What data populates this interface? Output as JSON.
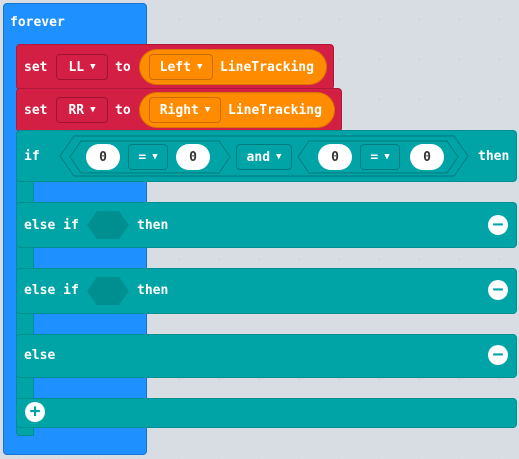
{
  "forever": {
    "label": "forever"
  },
  "set_ll": {
    "set": "set",
    "var": "LL",
    "to": "to",
    "side": "Left",
    "func": "LineTracking"
  },
  "set_rr": {
    "set": "set",
    "var": "RR",
    "to": "to",
    "side": "Right",
    "func": "LineTracking"
  },
  "if_block": {
    "if": "if",
    "left_a": "0",
    "op_a": "=",
    "right_a": "0",
    "and": "and",
    "left_b": "0",
    "op_b": "=",
    "right_b": "0",
    "then": "then"
  },
  "elseif1": {
    "label": "else if",
    "then": "then"
  },
  "elseif2": {
    "label": "else if",
    "then": "then"
  },
  "else": {
    "label": "else"
  },
  "icons": {
    "remove": "minus-circle-icon",
    "add": "plus-circle-icon",
    "dropdown": "caret-down-icon"
  },
  "colors": {
    "forever": "#1e90ff",
    "variables": "#d41f44",
    "logic": "#00a4a6",
    "linetracking": "#ff8c00"
  }
}
